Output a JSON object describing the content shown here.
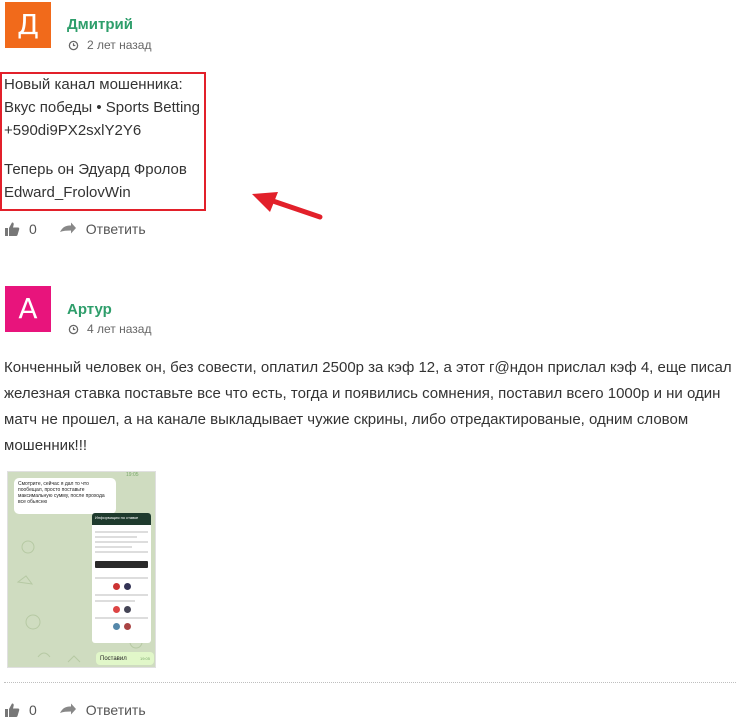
{
  "comments": [
    {
      "avatar_letter": "Д",
      "avatar_color": "#f16a1b",
      "author": "Дмитрий",
      "time": "2 лет назад",
      "lines": [
        "Новый канал мошенника:",
        "Вкус победы • Sports Betting",
        "+590di9PX2sxlY2Y6",
        "Теперь он Эдуард Фролов",
        "Edward_FrolovWin"
      ],
      "likes": "0",
      "reply_label": "Ответить"
    },
    {
      "avatar_letter": "А",
      "avatar_color": "#e8147c",
      "author": "Артур",
      "time": "4 лет назад",
      "text": "Конченный человек он, без совести, оплатил 2500р за кэф 12, а этот г@ндон прислал кэф 4, еще писал железная ставка поставьте все что есть, тогда и появились сомнения, поставил всего 1000р и ни один матч не прошел, а на канале выкладывает чужие скрины, либо отредактированые, одним словом мошенник!!!",
      "screenshot": {
        "message_text": "Смотрите, сейчас я дал то что пообещал, просто поставьте максимальную сумму, после прохода все обьясню",
        "message_time": "19:05",
        "card_title": "Информация по ставке",
        "card_button": "Показать все матчи",
        "reply_text": "Поставил",
        "reply_time": "19:05"
      },
      "likes": "0",
      "reply_label": "Ответить"
    }
  ],
  "colors": {
    "author": "#2e9e6b",
    "highlight": "#e2202a",
    "arrow": "#e2202a"
  }
}
